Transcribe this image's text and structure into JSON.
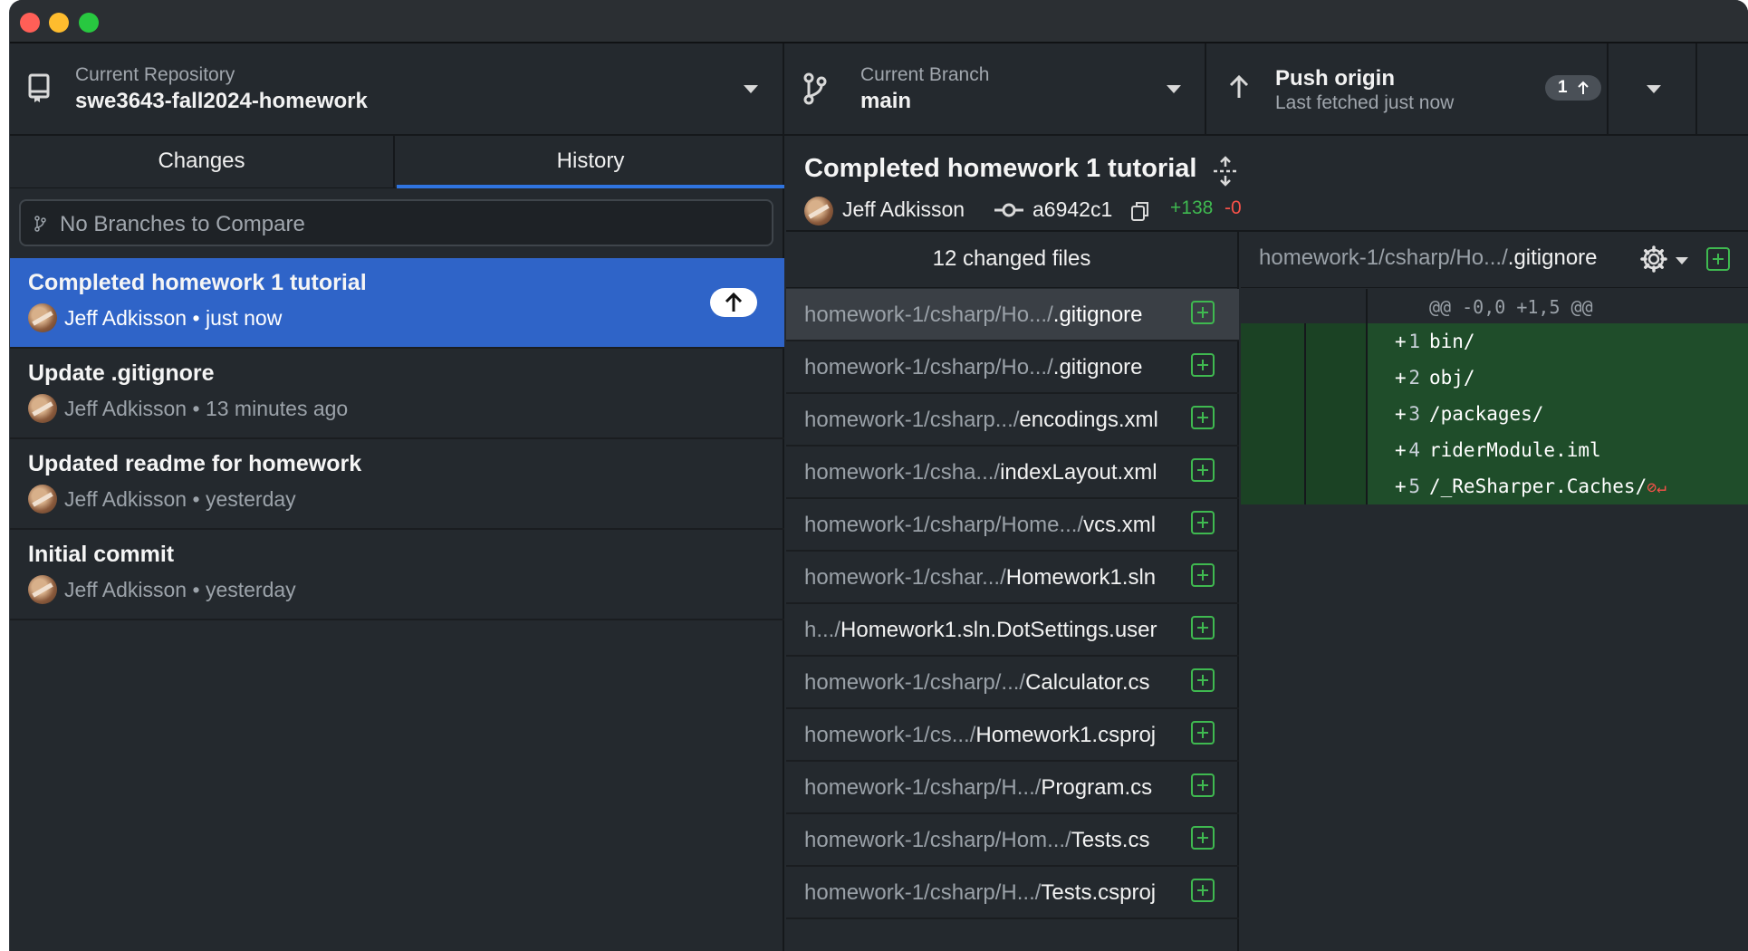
{
  "toolbar": {
    "repo_label": "Current Repository",
    "repo_name": "swe3643-fall2024-homework",
    "branch_label": "Current Branch",
    "branch_name": "main",
    "push_title": "Push origin",
    "push_sub": "Last fetched just now",
    "push_count": "1"
  },
  "tabs": {
    "changes": "Changes",
    "history": "History"
  },
  "compare": {
    "text": "No Branches to Compare"
  },
  "commits": [
    {
      "title": "Completed homework 1 tutorial",
      "author": "Jeff Adkisson",
      "time": "just now"
    },
    {
      "title": "Update .gitignore",
      "author": "Jeff Adkisson",
      "time": "13 minutes ago"
    },
    {
      "title": "Updated readme for homework",
      "author": "Jeff Adkisson",
      "time": "yesterday"
    },
    {
      "title": "Initial commit",
      "author": "Jeff Adkisson",
      "time": "yesterday"
    }
  ],
  "detail": {
    "title": "Completed homework 1 tutorial",
    "author": "Jeff Adkisson",
    "sha": "a6942c1",
    "additions": "+138",
    "deletions": "-0"
  },
  "files_header": "12 changed files",
  "files": [
    {
      "dir": "homework-1/csharp/Ho.../",
      "name": ".gitignore"
    },
    {
      "dir": "homework-1/csharp/Ho.../",
      "name": ".gitignore"
    },
    {
      "dir": "homework-1/csharp.../",
      "name": "encodings.xml"
    },
    {
      "dir": "homework-1/csha.../",
      "name": "indexLayout.xml"
    },
    {
      "dir": "homework-1/csharp/Home.../",
      "name": "vcs.xml"
    },
    {
      "dir": "homework-1/cshar.../",
      "name": "Homework1.sln"
    },
    {
      "dir": "h.../",
      "name": "Homework1.sln.DotSettings.user"
    },
    {
      "dir": "homework-1/csharp/.../",
      "name": "Calculator.cs"
    },
    {
      "dir": "homework-1/cs.../",
      "name": "Homework1.csproj"
    },
    {
      "dir": "homework-1/csharp/H.../",
      "name": "Program.cs"
    },
    {
      "dir": "homework-1/csharp/Hom.../",
      "name": "Tests.cs"
    },
    {
      "dir": "homework-1/csharp/H.../",
      "name": "Tests.csproj"
    }
  ],
  "diff": {
    "path_dir": "homework-1/csharp/Ho.../",
    "path_name": ".gitignore",
    "hunk": "@@ -0,0 +1,5 @@",
    "lines": [
      {
        "num": "1",
        "sign": "+",
        "code": "bin/"
      },
      {
        "num": "2",
        "sign": "+",
        "code": "obj/"
      },
      {
        "num": "3",
        "sign": "+",
        "code": "/packages/"
      },
      {
        "num": "4",
        "sign": "+",
        "code": "riderModule.iml"
      },
      {
        "num": "5",
        "sign": "+",
        "code": "/_ReSharper.Caches/"
      }
    ]
  },
  "colors": {
    "accent": "#2f64c8",
    "added": "#3fb950",
    "deleted": "#f85149"
  }
}
